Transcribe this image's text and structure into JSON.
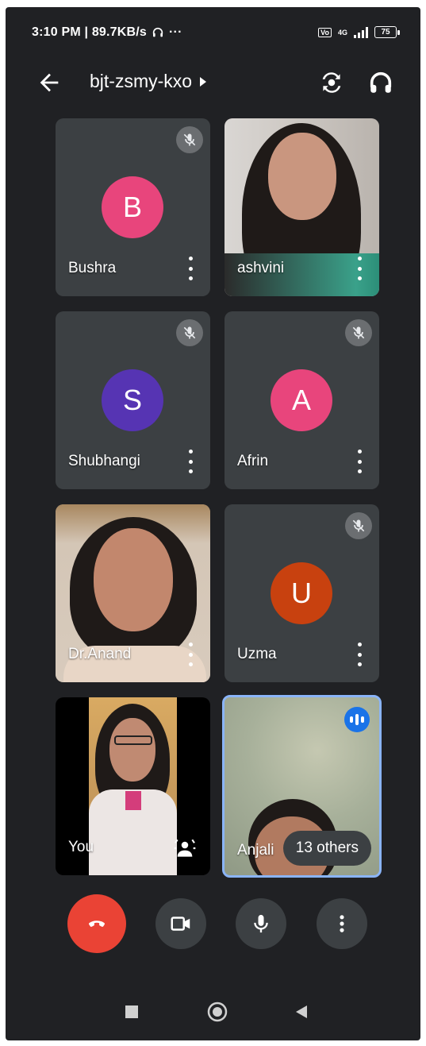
{
  "status_bar": {
    "time_speed": "3:10 PM | 89.7KB/s",
    "more": "···",
    "network": "4G",
    "volte": "Vo",
    "battery": "75"
  },
  "header": {
    "meeting_code": "bjt-zsmy-kxo"
  },
  "participants": [
    {
      "name": "Bushra",
      "initial": "B",
      "color": "#e8457c",
      "muted": true
    },
    {
      "name": "ashvini",
      "video": true
    },
    {
      "name": "Shubhangi",
      "initial": "S",
      "color": "#5634b3",
      "muted": true
    },
    {
      "name": "Afrin",
      "initial": "A",
      "color": "#e8457c",
      "muted": true
    },
    {
      "name": "Dr.Anand",
      "video": true
    },
    {
      "name": "Uzma",
      "initial": "U",
      "color": "#c8410f",
      "muted": true
    },
    {
      "name": "You",
      "video": true
    },
    {
      "name": "Anjali",
      "video": true,
      "speaking": true
    }
  ],
  "others_chip": "13 others",
  "colors": {
    "background": "#202124",
    "tile": "#3c4043",
    "end_call": "#ea4335",
    "active_speaker_border": "#8ab4f8"
  }
}
